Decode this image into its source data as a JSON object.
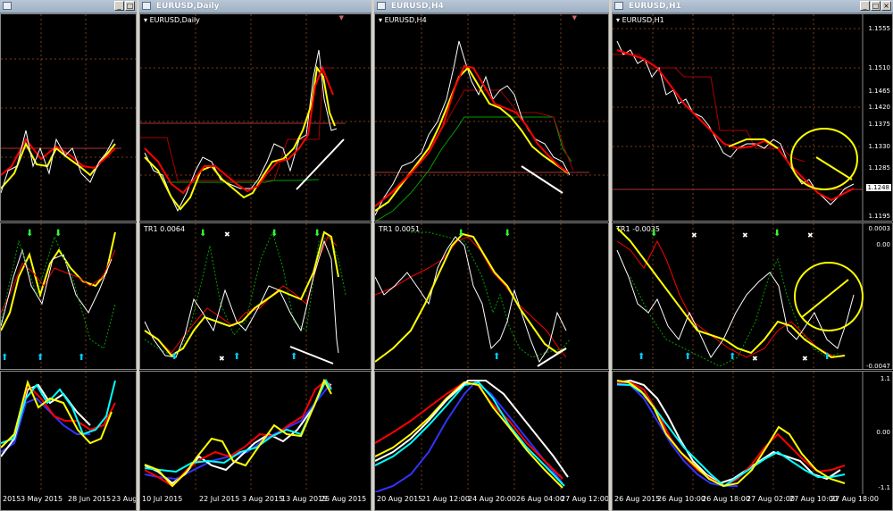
{
  "windows": [
    {
      "id": "w1",
      "title": "",
      "symbol": "",
      "tr_label": "",
      "x_ticks": [
        "2015",
        "3 May 2015",
        "28 Jun 2015",
        "23 Aug"
      ],
      "y_ticks": []
    },
    {
      "id": "w2",
      "title": "EURUSD,Daily",
      "symbol": "EURUSD,Daily",
      "tr_label": "TR1 0.0064",
      "x_ticks": [
        "10 Jul 2015",
        "22 Jul 2015",
        "3 Aug 2015",
        "13 Aug 2015",
        "25 Aug 2015"
      ],
      "y_ticks": []
    },
    {
      "id": "w3",
      "title": "EURUSD,H4",
      "symbol": "EURUSD,H4",
      "tr_label": "TR1 0.0051",
      "x_ticks": [
        "20 Aug 2015",
        "21 Aug 12:00",
        "24 Aug 20:00",
        "26 Aug 04:00",
        "27 Aug 12:00"
      ],
      "y_ticks": []
    },
    {
      "id": "w4",
      "title": "EURUSD,H1",
      "symbol": "EURUSD,H1",
      "tr_label": "TR1 -0.0035",
      "x_ticks": [
        "26 Aug 2015",
        "26 Aug 10:00",
        "26 Aug 18:00",
        "27 Aug 02:00",
        "27 Aug 10:00",
        "27 Aug 18:00"
      ],
      "price_ticks": [
        "1.1555",
        "1.1510",
        "1.1465",
        "1.1420",
        "1.1375",
        "1.1330",
        "1.1285",
        "1.1195"
      ],
      "current_price": "1.1248",
      "osc_ticks": [
        "0.0003",
        "0.00",
        "-0.0047"
      ],
      "stoch_ticks": [
        "1.1",
        "0.00",
        "-1.1"
      ]
    }
  ],
  "colors": {
    "background": "#000000",
    "grid": "#7a3b16",
    "price": "#ffffff",
    "fast_ma": "#ff0000",
    "slow_ma": "#ffff00",
    "trend": "#00a000",
    "blue": "#3333ff",
    "cyan": "#00ffff",
    "annotation_line": "#ffffff",
    "highlight_circle": "#ffff00",
    "title_bar": "#a8b8ca"
  },
  "icons": [
    "window-icon",
    "minimize-icon",
    "maximize-icon",
    "close-icon",
    "up-arrow-icon",
    "down-arrow-icon",
    "cross-icon"
  ]
}
